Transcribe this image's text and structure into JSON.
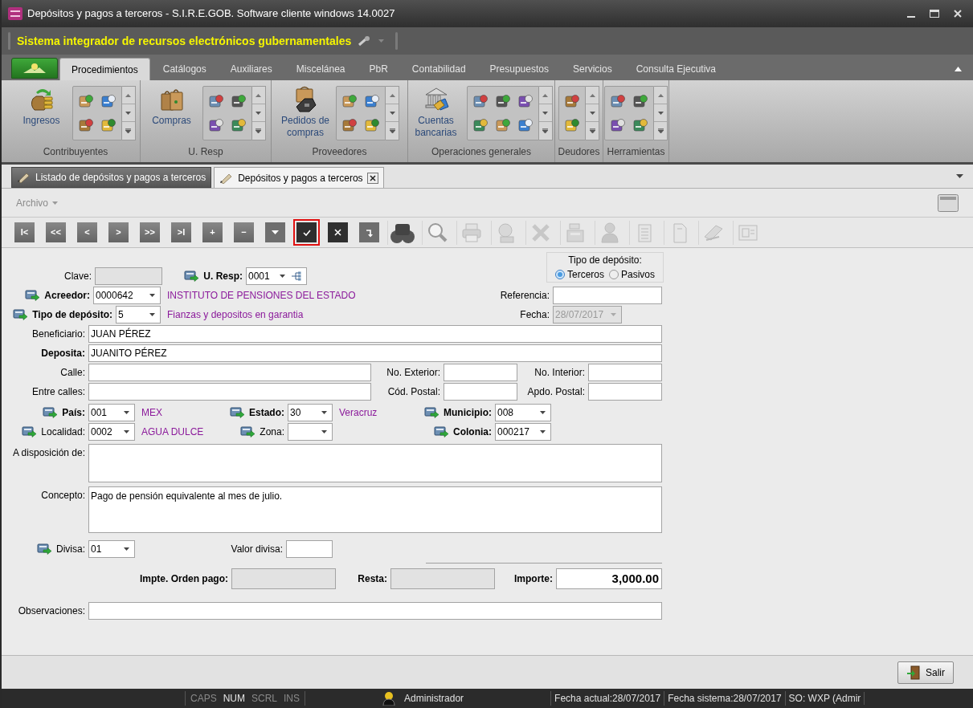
{
  "window": {
    "title": "Depósitos y pagos a terceros - S.I.R.E.GOB. Software cliente windows 14.0027",
    "app_name": "Sistema integrador de recursos electrónicos gubernamentales"
  },
  "ribbon": {
    "tabs": [
      {
        "label": "Procedimientos",
        "selected": true
      },
      {
        "label": "Catálogos",
        "selected": false
      },
      {
        "label": "Auxiliares",
        "selected": false
      },
      {
        "label": "Miscelánea",
        "selected": false
      },
      {
        "label": "PbR",
        "selected": false
      },
      {
        "label": "Contabilidad",
        "selected": false
      },
      {
        "label": "Presupuestos",
        "selected": false
      },
      {
        "label": "Servicios",
        "selected": false
      },
      {
        "label": "Consulta Ejecutiva",
        "selected": false
      }
    ],
    "groups": [
      {
        "label": "Contribuyentes",
        "button": "Ingresos"
      },
      {
        "label": "U. Resp",
        "button": "Compras"
      },
      {
        "label": "Proveedores",
        "button": "Pedidos de compras"
      },
      {
        "label": "Operaciones generales",
        "button": "Cuentas bancarias"
      },
      {
        "label": "Deudores"
      },
      {
        "label": "Herramientas"
      }
    ]
  },
  "doc_tabs": [
    {
      "label": "Listado de depósitos y pagos a terceros",
      "selected": false,
      "closable": false
    },
    {
      "label": "Depósitos y pagos a terceros",
      "selected": true,
      "closable": true
    }
  ],
  "menu": {
    "label": "Archivo"
  },
  "toolbar": [
    {
      "kind": "text",
      "label": "I<",
      "highlighted": false
    },
    {
      "kind": "text",
      "label": "<<",
      "highlighted": false
    },
    {
      "kind": "text",
      "label": "<",
      "highlighted": false
    },
    {
      "kind": "text",
      "label": ">",
      "highlighted": false
    },
    {
      "kind": "text",
      "label": ">>",
      "highlighted": false
    },
    {
      "kind": "text",
      "label": ">I",
      "highlighted": false
    },
    {
      "kind": "text",
      "label": "+",
      "highlighted": false
    },
    {
      "kind": "text",
      "label": "−",
      "highlighted": false
    },
    {
      "kind": "icon",
      "highlighted": false
    },
    {
      "kind": "icon",
      "highlighted": true
    },
    {
      "kind": "icon",
      "highlighted": false
    },
    {
      "kind": "icon",
      "highlighted": false
    },
    {
      "kind": "tool",
      "disabled": false
    },
    {
      "kind": "tool",
      "disabled": false
    },
    {
      "kind": "tool",
      "disabled": true
    },
    {
      "kind": "tool",
      "disabled": true
    },
    {
      "kind": "tool",
      "disabled": true
    },
    {
      "kind": "tool",
      "disabled": true
    },
    {
      "kind": "tool",
      "disabled": true
    },
    {
      "kind": "tool",
      "disabled": true
    },
    {
      "kind": "tool",
      "disabled": true
    },
    {
      "kind": "tool",
      "disabled": true
    },
    {
      "kind": "tool",
      "disabled": true
    }
  ],
  "form": {
    "clave": {
      "label": "Clave:",
      "kind": "text",
      "bold": false,
      "lookup": false,
      "disabled": true
    },
    "u_resp": {
      "label": "U. Resp:",
      "kind": "combo",
      "value": "0001",
      "bold": true,
      "lookup": true,
      "disabled": false,
      "tree": true
    },
    "tipo_deposito_group": {
      "label": "Tipo de depósito:",
      "options": [
        {
          "label": "Terceros",
          "selected": true
        },
        {
          "label": "Pasivos",
          "selected": false
        }
      ]
    },
    "acreedor": {
      "label": "Acreedor:",
      "kind": "combo",
      "value": "0000642",
      "bold": true,
      "lookup": true,
      "disabled": false,
      "note": "INSTITUTO DE PENSIONES DEL ESTADO"
    },
    "referencia": {
      "label": "Referencia:",
      "kind": "text",
      "bold": false,
      "lookup": false,
      "disabled": false
    },
    "tipo_deposito": {
      "label": "Tipo de depósito:",
      "kind": "combo",
      "value": "5",
      "bold": true,
      "lookup": true,
      "disabled": false,
      "note": "Fianzas y depositos en garantia"
    },
    "fecha": {
      "label": "Fecha:",
      "kind": "combo",
      "value": "28/07/2017",
      "bold": false,
      "lookup": false,
      "disabled": true
    },
    "beneficiario": {
      "label": "Beneficiario:",
      "kind": "text",
      "value": "JUAN PÉREZ",
      "bold": false,
      "lookup": false,
      "disabled": false
    },
    "deposita": {
      "label": "Deposita:",
      "kind": "text",
      "value": "JUANITO PÉREZ",
      "bold": true,
      "lookup": false,
      "disabled": false
    },
    "calle": {
      "label": "Calle:",
      "kind": "text",
      "bold": false,
      "lookup": false,
      "disabled": false
    },
    "no_exterior": {
      "label": "No. Exterior:",
      "kind": "text",
      "bold": false,
      "lookup": false,
      "disabled": false
    },
    "no_interior": {
      "label": "No. Interior:",
      "kind": "text",
      "bold": false,
      "lookup": false,
      "disabled": false
    },
    "entre_calles": {
      "label": "Entre calles:",
      "kind": "text",
      "bold": false,
      "lookup": false,
      "disabled": false
    },
    "cod_postal": {
      "label": "Cód. Postal:",
      "kind": "text",
      "bold": false,
      "lookup": false,
      "disabled": false
    },
    "apdo_postal": {
      "label": "Apdo. Postal:",
      "kind": "text",
      "bold": false,
      "lookup": false,
      "disabled": false
    },
    "pais": {
      "label": "País:",
      "kind": "combo",
      "value": "001",
      "bold": true,
      "lookup": true,
      "disabled": false,
      "note": "MEX"
    },
    "estado": {
      "label": "Estado:",
      "kind": "combo",
      "value": "30",
      "bold": true,
      "lookup": true,
      "disabled": false,
      "note": "Veracruz"
    },
    "municipio": {
      "label": "Municipio:",
      "kind": "combo",
      "value": "008",
      "bold": true,
      "lookup": true,
      "disabled": false
    },
    "localidad": {
      "label": "Localidad:",
      "kind": "combo",
      "value": "0002",
      "bold": false,
      "lookup": true,
      "disabled": false,
      "note": "AGUA DULCE"
    },
    "zona": {
      "label": "Zona:",
      "kind": "combo",
      "bold": false,
      "lookup": true,
      "disabled": false
    },
    "colonia": {
      "label": "Colonia:",
      "kind": "combo",
      "value": "000217",
      "bold": true,
      "lookup": true,
      "disabled": false
    },
    "a_disposicion": {
      "label": "A disposición de:",
      "kind": "area",
      "bold": false,
      "lookup": false,
      "disabled": false
    },
    "concepto": {
      "label": "Concepto:",
      "kind": "area",
      "value": "Pago de pensión equivalente al mes de julio.",
      "bold": false,
      "lookup": false,
      "disabled": false
    },
    "divisa": {
      "label": "Divisa:",
      "kind": "combo",
      "value": "01",
      "bold": false,
      "lookup": true,
      "disabled": false
    },
    "valor_divisa": {
      "label": "Valor divisa:",
      "kind": "text",
      "bold": false,
      "lookup": false,
      "disabled": false
    },
    "impte_orden_pago": {
      "label": "Impte. Orden pago:",
      "kind": "text",
      "bold": true,
      "lookup": false,
      "disabled": true
    },
    "resta": {
      "label": "Resta:",
      "kind": "text",
      "bold": true,
      "lookup": false,
      "disabled": true
    },
    "importe": {
      "label": "Importe:",
      "kind": "amount",
      "value": "3,000.00",
      "bold": true,
      "lookup": false,
      "disabled": false
    },
    "observaciones": {
      "label": "Observaciones:",
      "kind": "text",
      "bold": false,
      "lookup": false,
      "disabled": false
    }
  },
  "footer": {
    "button": "Salir"
  },
  "status_bar": {
    "keys": [
      {
        "label": "CAPS",
        "on": false
      },
      {
        "label": "NUM",
        "on": true
      },
      {
        "label": "SCRL",
        "on": false
      },
      {
        "label": "INS",
        "on": false
      }
    ],
    "user": "Administrador",
    "items": [
      "Fecha actual:28/07/2017",
      "Fecha sistema:28/07/2017",
      "SO: WXP (Admir"
    ]
  }
}
